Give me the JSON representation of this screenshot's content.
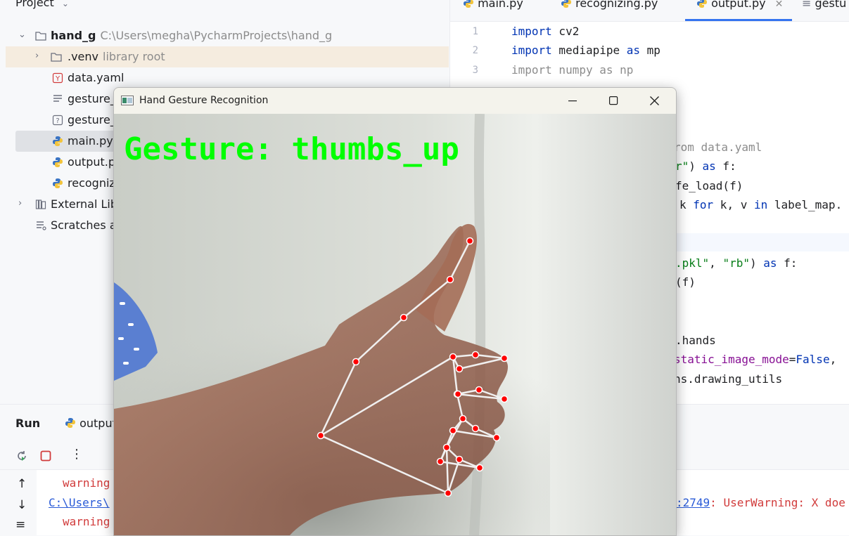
{
  "project": {
    "header": "Project",
    "tree": [
      {
        "label": "hand_g",
        "hint": "C:\\Users\\megha\\PycharmProjects\\hand_g",
        "icon": "folder-icon"
      },
      {
        "label": ".venv",
        "hint": "library root",
        "icon": "folder-icon"
      },
      {
        "label": "data.yaml",
        "icon": "yaml-file-icon"
      },
      {
        "label": "gesture_",
        "icon": "text-file-icon"
      },
      {
        "label": "gesture_",
        "icon": "unknown-file-icon"
      },
      {
        "label": "main.py",
        "icon": "python-file-icon"
      },
      {
        "label": "output.p",
        "icon": "python-file-icon"
      },
      {
        "label": "recogniz",
        "icon": "python-file-icon"
      },
      {
        "label": "External Lib",
        "icon": "library-icon"
      },
      {
        "label": "Scratches a",
        "icon": "scratches-icon"
      }
    ]
  },
  "editor": {
    "tabs": [
      {
        "label": "main.py",
        "icon": "python-file-icon"
      },
      {
        "label": "recognizing.py",
        "icon": "python-file-icon"
      },
      {
        "label": "output.py",
        "icon": "python-file-icon",
        "active": true
      },
      {
        "label": "gestu",
        "icon": "text-file-icon"
      }
    ],
    "line_numbers": [
      "1",
      "2",
      "3"
    ],
    "code": {
      "l1_kw": "import",
      "l1_rest": " cv2",
      "l2_kw": "import",
      "l2_mod": " mediapipe ",
      "l2_as": "as",
      "l2_alias": " mp",
      "l3": "import numpy as np",
      "l7": "rom data.yaml",
      "l8_str": "r\"",
      "l8_rest": ") ",
      "l8_kw": "as",
      "l8_end": " f:",
      "l9": "fe_load(f)",
      "l10_a": "k ",
      "l10_for": "for",
      "l10_b": " k, v ",
      "l10_in": "in",
      "l10_c": " label_map.",
      "l12_str": ".pkl\"",
      "l12_b": ", ",
      "l12_str2": "\"rb\"",
      "l12_c": ") ",
      "l12_as": "as",
      "l12_d": " f:",
      "l13": "(f)",
      "l16": ".hands",
      "l17_prm": "static_image_mode",
      "l17_rest": "=",
      "l17_kw": "False",
      "l17_end": ",",
      "l18": "ns.drawing_utils"
    }
  },
  "run": {
    "title": "Run",
    "tab_label": "output",
    "console": {
      "warn1": "warning",
      "path": "C:\\Users\\",
      "warn2": "warning",
      "right_link": ":2749",
      "right_text": ": UserWarning: X doe"
    }
  },
  "cv_window": {
    "title": "Hand Gesture Recognition",
    "overlay_text": "Gesture: thumbs_up",
    "overlay_color": "#00ff00"
  },
  "colors": {
    "landmark": "#ff0000",
    "connection": "#f0f0f0"
  }
}
